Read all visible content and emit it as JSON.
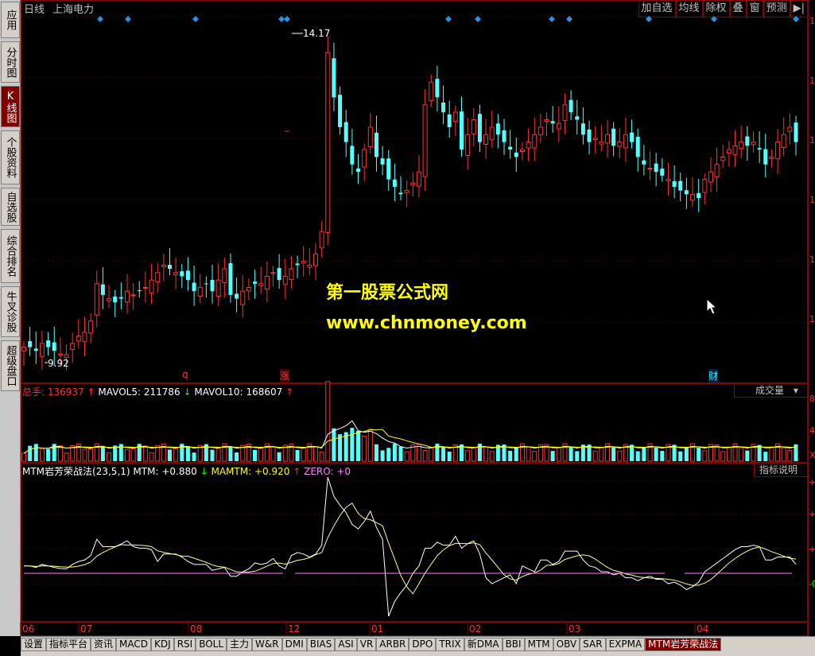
{
  "sidebar": {
    "tabs": [
      {
        "label": "应用",
        "name": "app"
      },
      {
        "label": "分时图",
        "name": "intraday"
      },
      {
        "label": "K线图",
        "name": "kline",
        "active": true
      },
      {
        "label": "个股资料",
        "name": "stock-info"
      },
      {
        "label": "自选股",
        "name": "watchlist"
      },
      {
        "label": "综合排名",
        "name": "ranking"
      },
      {
        "label": "牛叉诊股",
        "name": "diagnose"
      },
      {
        "label": "超级盘口",
        "name": "super-panel"
      }
    ]
  },
  "header": {
    "period": "日线",
    "stock_name": "上海电力",
    "buttons": [
      "加自选",
      "均线",
      "除权",
      "叠",
      "窗",
      "预测",
      "▶|"
    ]
  },
  "price_chart": {
    "high_label": "14.17",
    "low_label": "9.92",
    "event_markers": [
      {
        "label": "q",
        "color": "#ff3030"
      },
      {
        "label": "涨",
        "color": "#ff3030"
      },
      {
        "label": "财",
        "color": "#00ffff"
      }
    ],
    "scale_digits": [
      "1",
      "1",
      "1",
      "1",
      "1",
      "1",
      "1",
      "1",
      "1"
    ]
  },
  "watermark": {
    "line1": "第一股票公式网",
    "line2": "www.chnmoney.com"
  },
  "volume_panel": {
    "total_label": "总手:",
    "total_value": "136937",
    "total_arrow": "↑",
    "mavol5_label": "MAVOL5:",
    "mavol5_value": "211786",
    "mavol5_arrow": "↓",
    "mavol10_label": "MAVOL10:",
    "mavol10_value": "168607",
    "mavol10_arrow": "↑",
    "dropdown": "成交量",
    "scale": [
      "8",
      "4",
      "X"
    ]
  },
  "indicator_panel": {
    "name": "MTM岩芳荣战法(23,5,1)",
    "mtm_label": "MTM:",
    "mtm_value": "+0.880",
    "mtm_arrow": "↓",
    "mamtm_label": "MAMTM:",
    "mamtm_value": "+0.920",
    "mamtm_arrow": "↑",
    "zero_label": "ZERO:",
    "zero_value": "+0",
    "help_button": "指标说明",
    "scale": [
      "+",
      "+",
      "+",
      "-0"
    ]
  },
  "x_axis": {
    "months": [
      "06",
      "07",
      "08",
      "12",
      "01",
      "02",
      "03",
      "04"
    ]
  },
  "bottom_tabs": [
    "设置",
    "指标平台",
    "资讯",
    "MACD",
    "KDJ",
    "RSI",
    "BOLL",
    "主力",
    "W&R",
    "DMI",
    "BIAS",
    "ASI",
    "VR",
    "ARBR",
    "DPO",
    "TRIX",
    "新DMA",
    "BBI",
    "MTM",
    "OBV",
    "SAR",
    "EXPMA",
    "MTM岩芳荣战法"
  ],
  "bottom_active": "MTM岩芳荣战法",
  "colors": {
    "up": "#ff3232",
    "down": "#54ffff",
    "border": "#8b0000",
    "ma5": "#ffffff",
    "ma10": "#ffff00",
    "zero_line": "#ff80ff"
  },
  "chart_data": {
    "type": "candlestick",
    "x_labels": [
      "06",
      "07",
      "08",
      "12",
      "01",
      "02",
      "03",
      "04"
    ],
    "price_high": 14.17,
    "price_low": 9.92,
    "close_prices": [
      10.05,
      10.05,
      10.0,
      10.1,
      10.05,
      10.0,
      9.96,
      9.95,
      10.1,
      10.2,
      10.25,
      10.4,
      10.9,
      10.75,
      10.7,
      10.65,
      10.7,
      10.8,
      10.75,
      10.8,
      10.85,
      10.95,
      11.05,
      11.15,
      11.1,
      11.05,
      11.0,
      10.95,
      10.8,
      10.85,
      10.9,
      10.8,
      10.95,
      11.1,
      10.75,
      10.7,
      10.8,
      10.85,
      10.9,
      10.9,
      11.0,
      11.05,
      10.95,
      11.0,
      11.1,
      11.15,
      11.2,
      11.15,
      11.3,
      11.6,
      14.0,
      13.4,
      13.0,
      12.8,
      12.5,
      12.4,
      12.7,
      13.0,
      12.6,
      12.5,
      12.3,
      12.2,
      12.1,
      12.15,
      12.25,
      12.4,
      13.3,
      13.6,
      13.4,
      13.2,
      13.0,
      13.2,
      12.7,
      12.9,
      13.1,
      12.8,
      12.9,
      13.0,
      12.9,
      12.8,
      12.7,
      12.6,
      12.7,
      12.8,
      12.9,
      13.0,
      13.1,
      13.05,
      13.05,
      13.3,
      13.2,
      13.1,
      12.9,
      12.8,
      12.85,
      12.8,
      12.9,
      12.75,
      12.8,
      12.9,
      12.8,
      12.6,
      12.5,
      12.45,
      12.4,
      12.35,
      12.3,
      12.2,
      12.15,
      12.1,
      12.1,
      12.05,
      12.3,
      12.4,
      12.5,
      12.6,
      12.7,
      12.75,
      12.8,
      12.75,
      12.8,
      12.7,
      12.5,
      12.6,
      12.8,
      12.9,
      13.0,
      12.8
    ],
    "volume_scale_ticks": [
      "8",
      "4",
      "X"
    ],
    "indicator": {
      "name": "MTM岩芳荣战法(23,5,1)",
      "MTM": 0.88,
      "MAMTM": 0.92,
      "ZERO": 0
    }
  }
}
